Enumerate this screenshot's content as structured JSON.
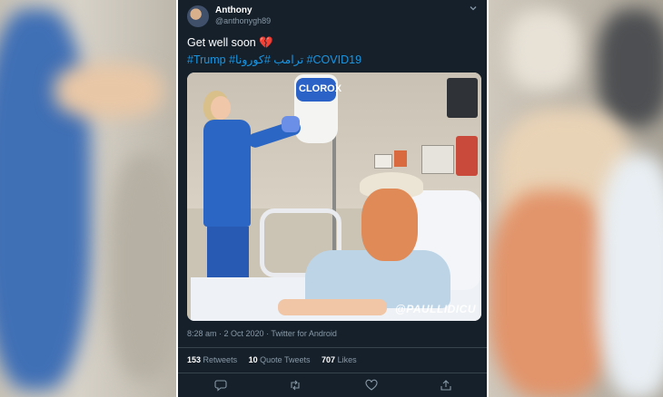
{
  "tweet": {
    "author_name": "Anthony",
    "author_handle": "@anthonygh89",
    "text": "Get well soon",
    "emoji": "💔",
    "hashtags": [
      "#Trump",
      "#ترامب",
      "#كورونا",
      "#COVID19"
    ],
    "image_watermark": "@PAULLIDICU",
    "timestamp": "8:28 am · 2 Oct 2020",
    "client": "Twitter for Android",
    "stats": {
      "retweets_count": "153",
      "retweets_label": "Retweets",
      "quote_count": "10",
      "quote_label": "Quote Tweets",
      "likes_count": "707",
      "likes_label": "Likes"
    }
  },
  "icons": [
    "chevron-down-icon",
    "reply-icon",
    "retweet-icon",
    "like-icon",
    "share-icon"
  ],
  "colors": {
    "card_background": "#15202b",
    "link_blue": "#1b95e0",
    "muted_text": "#8899a6",
    "heart_red": "#dd2e44"
  }
}
